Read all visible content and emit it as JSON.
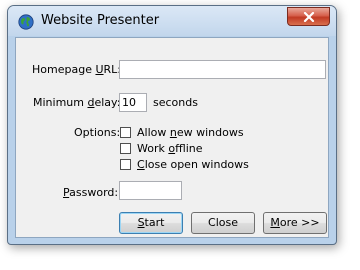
{
  "window": {
    "title": "Website Presenter",
    "app_icon": "globe-icon",
    "close_icon": "close-icon"
  },
  "form": {
    "homepage_label_prefix": "Homepage ",
    "homepage_label_accel": "U",
    "homepage_label_suffix": "RL:",
    "homepage_value": "",
    "delay_label_prefix": "Minimum ",
    "delay_label_accel": "d",
    "delay_label_suffix": "elay:",
    "delay_value": "10",
    "delay_unit": "seconds",
    "options_label": "Options:",
    "options": [
      {
        "prefix": "Allow ",
        "accel": "n",
        "suffix": "ew windows",
        "checked": false
      },
      {
        "prefix": "Work ",
        "accel": "o",
        "suffix": "ffline",
        "checked": false
      },
      {
        "prefix": "",
        "accel": "C",
        "suffix": "lose open windows",
        "checked": false
      }
    ],
    "password_label_prefix": "",
    "password_label_accel": "P",
    "password_label_suffix": "assword:",
    "password_value": ""
  },
  "buttons": {
    "start": {
      "accel": "S",
      "rest": "tart"
    },
    "close": {
      "label": "Close"
    },
    "more": {
      "accel": "M",
      "rest": "ore >>"
    }
  },
  "colors": {
    "frame": "#b9d1ea",
    "client": "#f0f0f0",
    "close_button": "#c13a24",
    "default_button_border": "#3c7fb1"
  }
}
